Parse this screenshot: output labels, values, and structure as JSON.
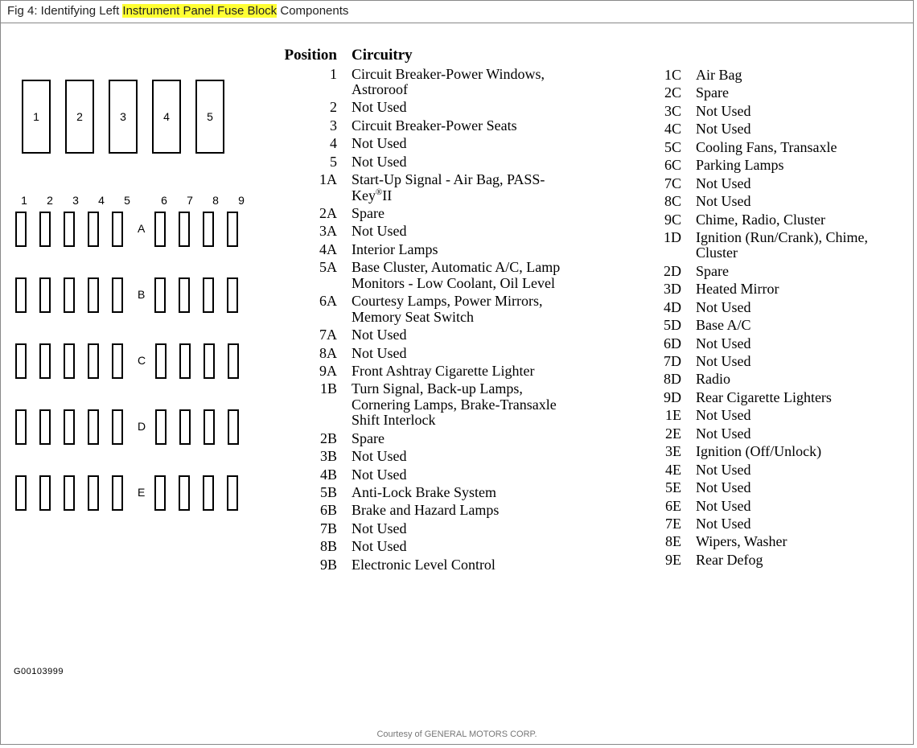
{
  "caption": {
    "prefix": "Fig 4: Identifying Left ",
    "highlight": "Instrument Panel Fuse Block",
    "suffix": " Components"
  },
  "partNumber": "G00103999",
  "courtesy": "Courtesy of GENERAL MOTORS CORP.",
  "breakers": [
    "1",
    "2",
    "3",
    "4",
    "5"
  ],
  "columns": [
    "1",
    "2",
    "3",
    "4",
    "5",
    "6",
    "7",
    "8",
    "9"
  ],
  "rowLabels": [
    "A",
    "B",
    "C",
    "D",
    "E"
  ],
  "headers": {
    "position": "Position",
    "circuitry": "Circuitry"
  },
  "col1": [
    {
      "pos": "1",
      "circ": "Circuit Breaker-Power Windows, Astroroof"
    },
    {
      "pos": "2",
      "circ": "Not Used"
    },
    {
      "pos": "3",
      "circ": "Circuit Breaker-Power Seats"
    },
    {
      "pos": "4",
      "circ": "Not Used"
    },
    {
      "pos": "5",
      "circ": "Not Used"
    },
    {
      "pos": "1A",
      "circ": "Start-Up Signal - Air Bag, PASS-Key®II"
    },
    {
      "pos": "2A",
      "circ": "Spare"
    },
    {
      "pos": "3A",
      "circ": "Not Used"
    },
    {
      "pos": "4A",
      "circ": "Interior Lamps"
    },
    {
      "pos": "5A",
      "circ": "Base Cluster, Automatic A/C, Lamp Monitors - Low Coolant, Oil Level"
    },
    {
      "pos": "6A",
      "circ": "Courtesy Lamps, Power Mirrors, Memory Seat Switch"
    },
    {
      "pos": "7A",
      "circ": "Not Used"
    },
    {
      "pos": "8A",
      "circ": "Not Used"
    },
    {
      "pos": "9A",
      "circ": "Front Ashtray Cigarette Lighter"
    },
    {
      "pos": "1B",
      "circ": "Turn Signal, Back-up Lamps, Cornering Lamps, Brake-Transaxle Shift Interlock"
    },
    {
      "pos": "2B",
      "circ": "Spare"
    },
    {
      "pos": "3B",
      "circ": "Not Used"
    },
    {
      "pos": "4B",
      "circ": "Not Used"
    },
    {
      "pos": "5B",
      "circ": "Anti-Lock Brake System"
    },
    {
      "pos": "6B",
      "circ": "Brake and Hazard Lamps"
    },
    {
      "pos": "7B",
      "circ": "Not Used"
    },
    {
      "pos": "8B",
      "circ": "Not Used"
    },
    {
      "pos": "9B",
      "circ": "Electronic Level Control"
    }
  ],
  "col2": [
    {
      "pos": "1C",
      "circ": "Air Bag"
    },
    {
      "pos": "2C",
      "circ": "Spare"
    },
    {
      "pos": "3C",
      "circ": "Not Used"
    },
    {
      "pos": "4C",
      "circ": "Not Used"
    },
    {
      "pos": "5C",
      "circ": "Cooling Fans, Transaxle"
    },
    {
      "pos": "6C",
      "circ": "Parking Lamps"
    },
    {
      "pos": "7C",
      "circ": "Not Used"
    },
    {
      "pos": "8C",
      "circ": "Not Used"
    },
    {
      "pos": "9C",
      "circ": "Chime, Radio, Cluster"
    },
    {
      "pos": "1D",
      "circ": "Ignition (Run/Crank), Chime, Cluster"
    },
    {
      "pos": "2D",
      "circ": "Spare"
    },
    {
      "pos": "3D",
      "circ": "Heated Mirror"
    },
    {
      "pos": "4D",
      "circ": "Not Used"
    },
    {
      "pos": "5D",
      "circ": "Base A/C"
    },
    {
      "pos": "6D",
      "circ": "Not Used"
    },
    {
      "pos": "7D",
      "circ": "Not Used"
    },
    {
      "pos": "8D",
      "circ": "Radio"
    },
    {
      "pos": "9D",
      "circ": "Rear Cigarette Lighters"
    },
    {
      "pos": "1E",
      "circ": "Not Used"
    },
    {
      "pos": "2E",
      "circ": "Not Used"
    },
    {
      "pos": "3E",
      "circ": "Ignition (Off/Unlock)"
    },
    {
      "pos": "4E",
      "circ": "Not Used"
    },
    {
      "pos": "5E",
      "circ": "Not Used"
    },
    {
      "pos": "6E",
      "circ": "Not Used"
    },
    {
      "pos": "7E",
      "circ": "Not Used"
    },
    {
      "pos": "8E",
      "circ": "Wipers, Washer"
    },
    {
      "pos": "9E",
      "circ": "Rear Defog"
    }
  ]
}
